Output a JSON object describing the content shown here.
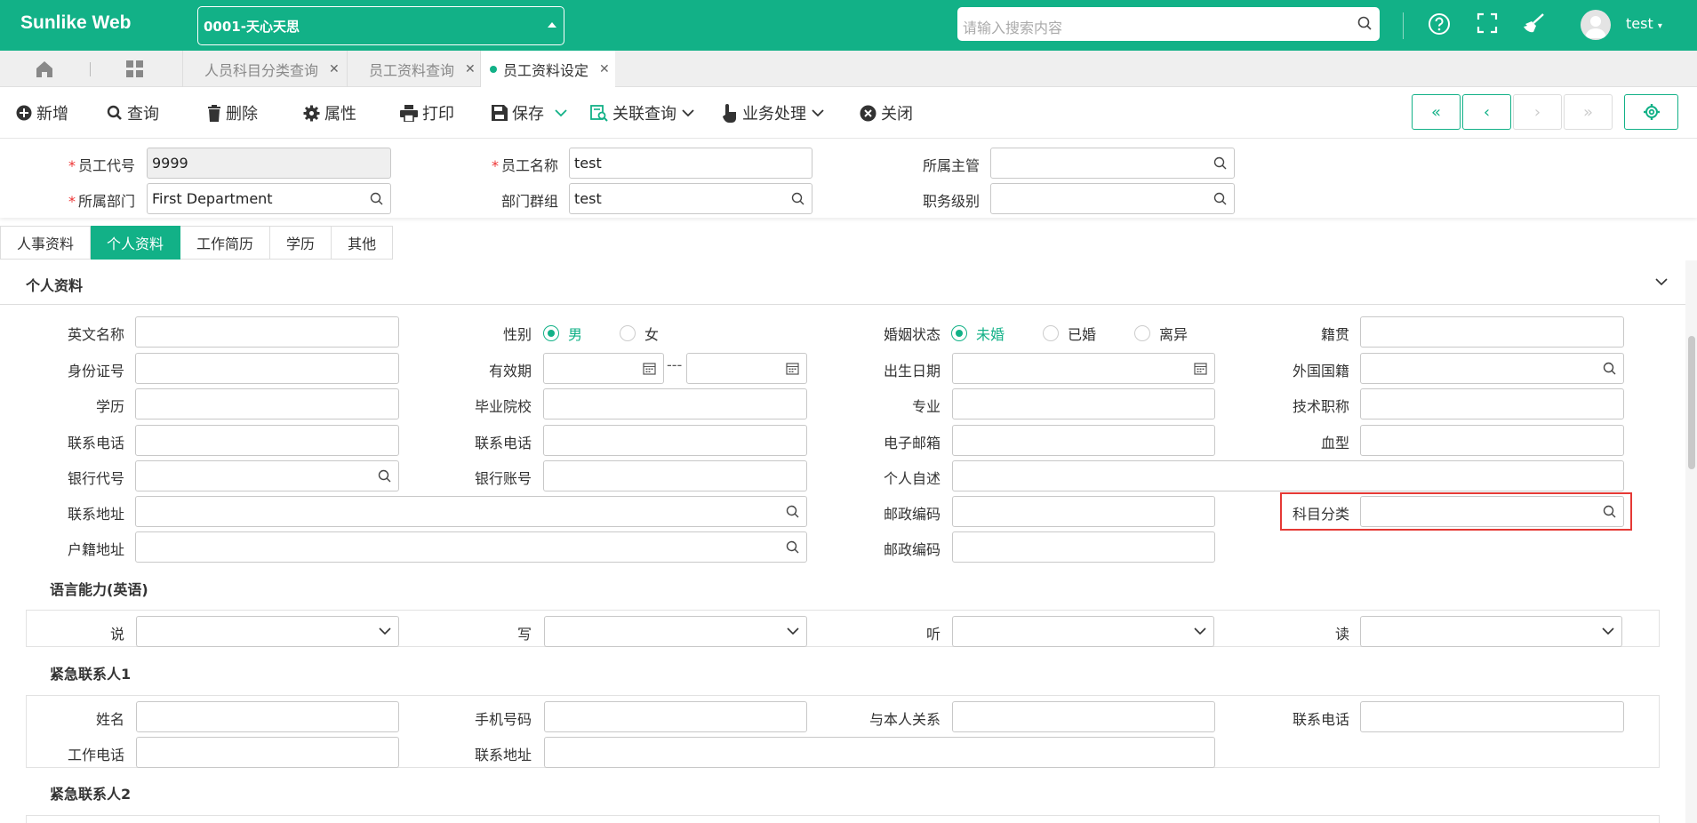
{
  "app": {
    "logo": "Sunlike Web",
    "company": "0001-天心天思",
    "search_placeholder": "请输入搜索内容",
    "user": "test",
    "accent": "#12b187"
  },
  "page_tabs": [
    {
      "label": "人员科目分类查询",
      "active": false
    },
    {
      "label": "员工资料查询",
      "active": false
    },
    {
      "label": "员工资料设定",
      "active": true
    }
  ],
  "toolbar": {
    "new": "新增",
    "query": "查询",
    "delete": "删除",
    "properties": "属性",
    "print": "打印",
    "save": "保存",
    "related_query": "关联查询",
    "business": "业务处理",
    "close": "关闭"
  },
  "header": {
    "emp_code_label": "员工代号",
    "emp_code_value": "9999",
    "emp_name_label": "员工名称",
    "emp_name_value": "test",
    "supervisor_label": "所属主管",
    "supervisor_value": "",
    "dept_label": "所属部门",
    "dept_value": "First Department",
    "dept_group_label": "部门群组",
    "dept_group_value": "test",
    "job_level_label": "职务级别",
    "job_level_value": ""
  },
  "sub_tabs": [
    {
      "label": "人事资料",
      "active": false
    },
    {
      "label": "个人资料",
      "active": true
    },
    {
      "label": "工作简历",
      "active": false
    },
    {
      "label": "学历",
      "active": false
    },
    {
      "label": "其他",
      "active": false
    }
  ],
  "personal": {
    "title": "个人资料",
    "english_name": "英文名称",
    "gender": "性别",
    "male": "男",
    "female": "女",
    "marital": "婚姻状态",
    "single": "未婚",
    "married": "已婚",
    "divorced": "离异",
    "native_place": "籍贯",
    "id_no": "身份证号",
    "valid_period": "有效期",
    "range_sep": "---",
    "birth_date": "出生日期",
    "nationality": "外国国籍",
    "education": "学历",
    "school": "毕业院校",
    "major": "专业",
    "title_rank": "技术职称",
    "phone1": "联系电话",
    "phone2": "联系电话",
    "email": "电子邮箱",
    "blood": "血型",
    "bank_code": "银行代号",
    "bank_account": "银行账号",
    "self_desc": "个人自述",
    "address": "联系地址",
    "postcode1": "邮政编码",
    "subject_class": "科目分类",
    "household_addr": "户籍地址",
    "postcode2": "邮政编码"
  },
  "language": {
    "title": "语言能力(英语)",
    "speak": "说",
    "write": "写",
    "listen": "听",
    "read": "读"
  },
  "emergency1": {
    "title": "紧急联系人1",
    "name": "姓名",
    "mobile": "手机号码",
    "relation": "与本人关系",
    "phone": "联系电话",
    "work_phone": "工作电话",
    "address": "联系地址"
  },
  "emergency2": {
    "title": "紧急联系人2"
  }
}
